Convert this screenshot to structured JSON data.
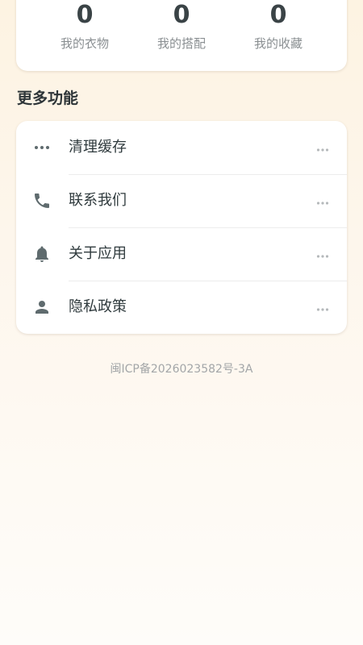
{
  "stats": [
    {
      "value": "0",
      "label": "我的衣物"
    },
    {
      "value": "0",
      "label": "我的搭配"
    },
    {
      "value": "0",
      "label": "我的收藏"
    }
  ],
  "section": {
    "title": "更多功能"
  },
  "menu": {
    "items": [
      {
        "label": "清理缓存",
        "icon": "more-horizontal-icon"
      },
      {
        "label": "联系我们",
        "icon": "phone-icon"
      },
      {
        "label": "关于应用",
        "icon": "bell-icon"
      },
      {
        "label": "隐私政策",
        "icon": "person-icon"
      }
    ]
  },
  "footer": {
    "icp": "闽ICP备2026023582号-3A"
  },
  "colors": {
    "icon": "#5f6b6e",
    "more_dots": "#b5b9bb",
    "text_primary": "#2f3a3d",
    "text_secondary": "#8a8f92"
  }
}
